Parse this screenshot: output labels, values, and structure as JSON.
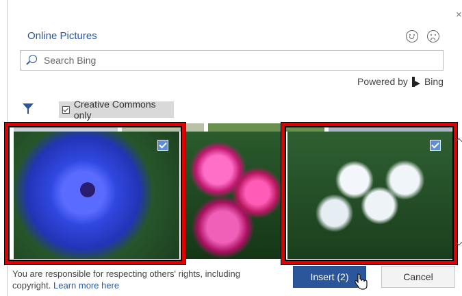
{
  "dialog": {
    "title": "Online Pictures",
    "close_glyph": "×",
    "feedback": {
      "smile_icon": "smile-icon",
      "frown_icon": "frown-icon"
    }
  },
  "search": {
    "placeholder": "Search Bing",
    "value": ""
  },
  "powered_by": {
    "prefix": "Powered by",
    "brand": "Bing"
  },
  "filters": {
    "creative_commons_label": "Creative Commons only",
    "creative_commons_checked": true
  },
  "results": [
    {
      "subject": "blue cornflower",
      "selected": true
    },
    {
      "subject": "pink sweet william",
      "selected": false
    },
    {
      "subject": "white phlox",
      "selected": true
    }
  ],
  "footer": {
    "notice": "You are responsible for respecting others' rights, including copyright.",
    "learn_more": "Learn more here"
  },
  "buttons": {
    "insert": "Insert (2)",
    "cancel": "Cancel"
  },
  "colors": {
    "accent": "#2b579a",
    "highlight": "#e00000",
    "selected_check": "#5b8fd6"
  }
}
